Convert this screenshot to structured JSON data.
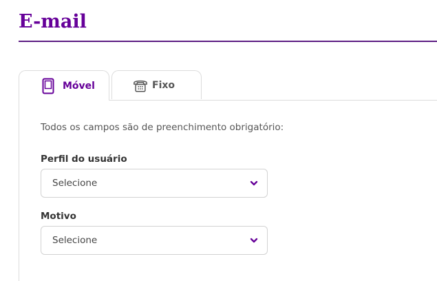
{
  "header": {
    "title": "E-mail"
  },
  "tabs": [
    {
      "label": "Móvel",
      "icon": "mobile-phone-icon",
      "active": true
    },
    {
      "label": "Fixo",
      "icon": "landline-phone-icon",
      "active": false
    }
  ],
  "form": {
    "intro": "Todos os campos são de preenchimento obrigatório:",
    "fields": [
      {
        "label": "Perfil do usuário",
        "selected": "Selecione"
      },
      {
        "label": "Motivo",
        "selected": "Selecione"
      }
    ]
  },
  "colors": {
    "accent": "#660099",
    "border": "#dcdcdc",
    "text": "#555555"
  }
}
